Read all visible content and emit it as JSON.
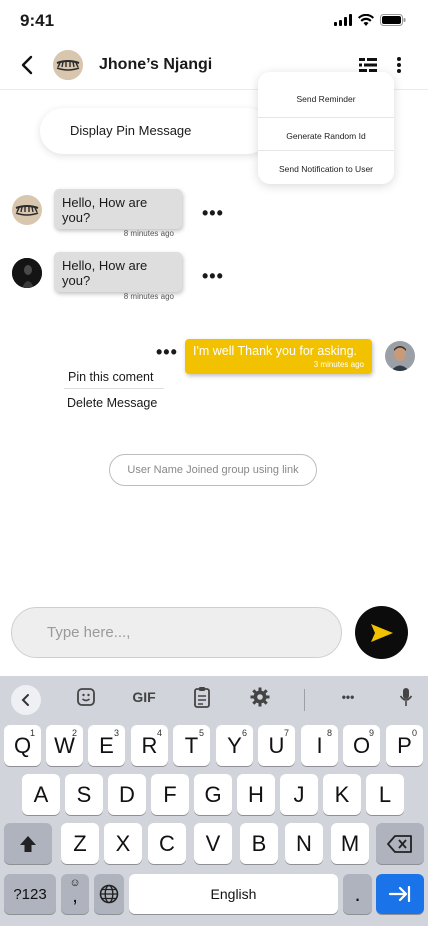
{
  "status_bar": {
    "time": "9:41"
  },
  "header": {
    "title": "Jhone’s Njangi"
  },
  "menu": {
    "items": [
      {
        "label": "Send Reminder"
      },
      {
        "label": "Generate Random Id"
      },
      {
        "label": "Send Notification to User"
      }
    ]
  },
  "pinned": {
    "label": "Display Pin Message"
  },
  "messages": [
    {
      "text": "Hello, How are you?",
      "time": "8 minutes ago"
    },
    {
      "text": "Hello, How are you?",
      "time": "8 minutes ago"
    },
    {
      "text": "I'm well Thank you for asking.",
      "time": "3 minutes ago"
    }
  ],
  "context_menu": {
    "pin_label": "Pin this coment",
    "delete_label": "Delete Message"
  },
  "system_message": "User Name Joined group using link",
  "composer": {
    "placeholder": "Type here...,"
  },
  "keyboard": {
    "toolbar": {
      "gif_label": "GIF",
      "more_label": "•••"
    },
    "row1": [
      {
        "key": "Q",
        "hint": "1"
      },
      {
        "key": "W",
        "hint": "2"
      },
      {
        "key": "E",
        "hint": "3"
      },
      {
        "key": "R",
        "hint": "4"
      },
      {
        "key": "T",
        "hint": "5"
      },
      {
        "key": "Y",
        "hint": "6"
      },
      {
        "key": "U",
        "hint": "7"
      },
      {
        "key": "I",
        "hint": "8"
      },
      {
        "key": "O",
        "hint": "9"
      },
      {
        "key": "P",
        "hint": "0"
      }
    ],
    "row2": [
      "A",
      "S",
      "D",
      "F",
      "G",
      "H",
      "J",
      "K",
      "L"
    ],
    "row3": [
      "Z",
      "X",
      "C",
      "V",
      "B",
      "N",
      "M"
    ],
    "bottom": {
      "symbols_label": "?123",
      "comma_label": ",",
      "space_label": "English",
      "period_label": "."
    }
  },
  "colors": {
    "accent_yellow": "#f2c200",
    "send_button": "#0c0c0c",
    "enter_key": "#1a73e8"
  }
}
